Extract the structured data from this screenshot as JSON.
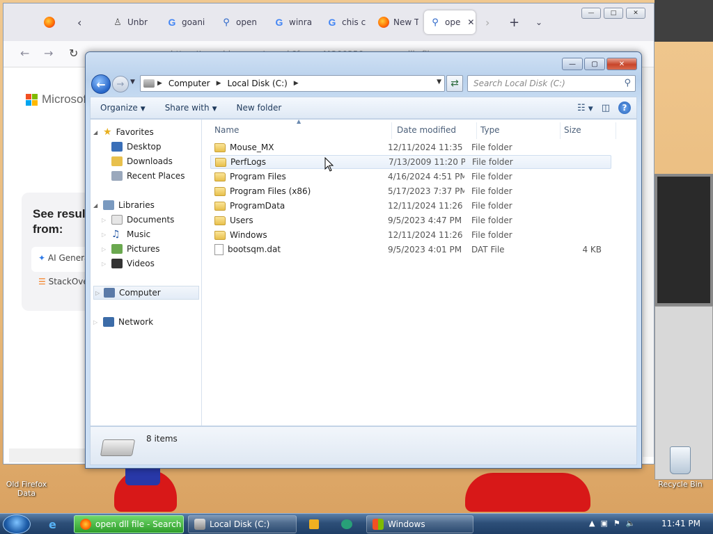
{
  "firefox": {
    "tabs": [
      {
        "label": "",
        "icon": "firefox-icon"
      },
      {
        "label": "Unbr",
        "icon": "unbreak-icon"
      },
      {
        "label": "goani",
        "icon": "google-icon"
      },
      {
        "label": "open",
        "icon": "search-icon"
      },
      {
        "label": "winra",
        "icon": "google-icon"
      },
      {
        "label": "chis c",
        "icon": "google-icon"
      },
      {
        "label": "New T",
        "icon": "firefox-icon"
      },
      {
        "label": "ope",
        "icon": "search-icon",
        "active": true
      }
    ],
    "url": "https://www.bing.com/search?form=MO0035&q=open+dll+file",
    "brand": "Microsoft",
    "see_results": "See results from:",
    "see_items": [
      "AI Genera",
      "StackOve"
    ]
  },
  "explorer": {
    "breadcrumb": [
      "Computer",
      "Local Disk (C:)"
    ],
    "search_placeholder": "Search Local Disk (C:)",
    "toolbar": {
      "organize": "Organize",
      "share": "Share with",
      "new_folder": "New folder"
    },
    "columns": {
      "name": "Name",
      "date": "Date modified",
      "type": "Type",
      "size": "Size"
    },
    "nav": {
      "favorites": "Favorites",
      "fav_items": [
        "Desktop",
        "Downloads",
        "Recent Places"
      ],
      "libraries": "Libraries",
      "lib_items": [
        "Documents",
        "Music",
        "Pictures",
        "Videos"
      ],
      "computer": "Computer",
      "network": "Network"
    },
    "rows": [
      {
        "name": "Mouse_MX",
        "date": "12/11/2024 11:35 ...",
        "type": "File folder",
        "size": "",
        "kind": "folder"
      },
      {
        "name": "PerfLogs",
        "date": "7/13/2009 11:20 PM",
        "type": "File folder",
        "size": "",
        "kind": "folder",
        "hover": true
      },
      {
        "name": "Program Files",
        "date": "4/16/2024 4:51 PM",
        "type": "File folder",
        "size": "",
        "kind": "folder"
      },
      {
        "name": "Program Files (x86)",
        "date": "5/17/2023 7:37 PM",
        "type": "File folder",
        "size": "",
        "kind": "folder"
      },
      {
        "name": "ProgramData",
        "date": "12/11/2024 11:26 ...",
        "type": "File folder",
        "size": "",
        "kind": "folder"
      },
      {
        "name": "Users",
        "date": "9/5/2023 4:47 PM",
        "type": "File folder",
        "size": "",
        "kind": "folder"
      },
      {
        "name": "Windows",
        "date": "12/11/2024 11:26 ...",
        "type": "File folder",
        "size": "",
        "kind": "folder"
      },
      {
        "name": "bootsqm.dat",
        "date": "9/5/2023 4:01 PM",
        "type": "DAT File",
        "size": "4 KB",
        "kind": "file"
      }
    ],
    "item_count": "8 items"
  },
  "desktop": {
    "icons": [
      "Old Firefox Data",
      "Recycle Bin"
    ]
  },
  "taskbar": {
    "items": [
      "open dll file - Search ...",
      "Local Disk (C:)",
      "Windows"
    ],
    "clock": "11:41 PM"
  }
}
